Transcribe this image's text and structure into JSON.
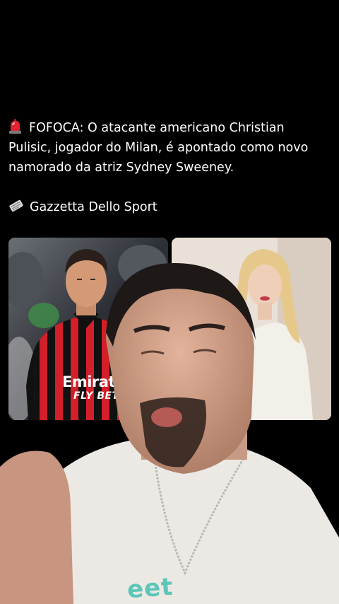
{
  "post": {
    "headline_emoji": "police-light-icon",
    "headline": "FOFOCA: O atacante americano Christian Pulisic, jogador do Milan, é apontado como novo namorado da atriz Sydney Sweeney.",
    "source_emoji": "newspaper-icon",
    "source": "Gazzetta Dello Sport"
  },
  "images": {
    "left": {
      "sponsor_line1": "Emirat",
      "sponsor_line2": "FLY BETTE"
    },
    "right": {}
  },
  "presenter": {
    "shirt_print": "eet"
  },
  "colors": {
    "background": "#000000",
    "text": "#ffffff",
    "milan_red": "#d21f2a",
    "shirt_white": "#ece9e4"
  }
}
